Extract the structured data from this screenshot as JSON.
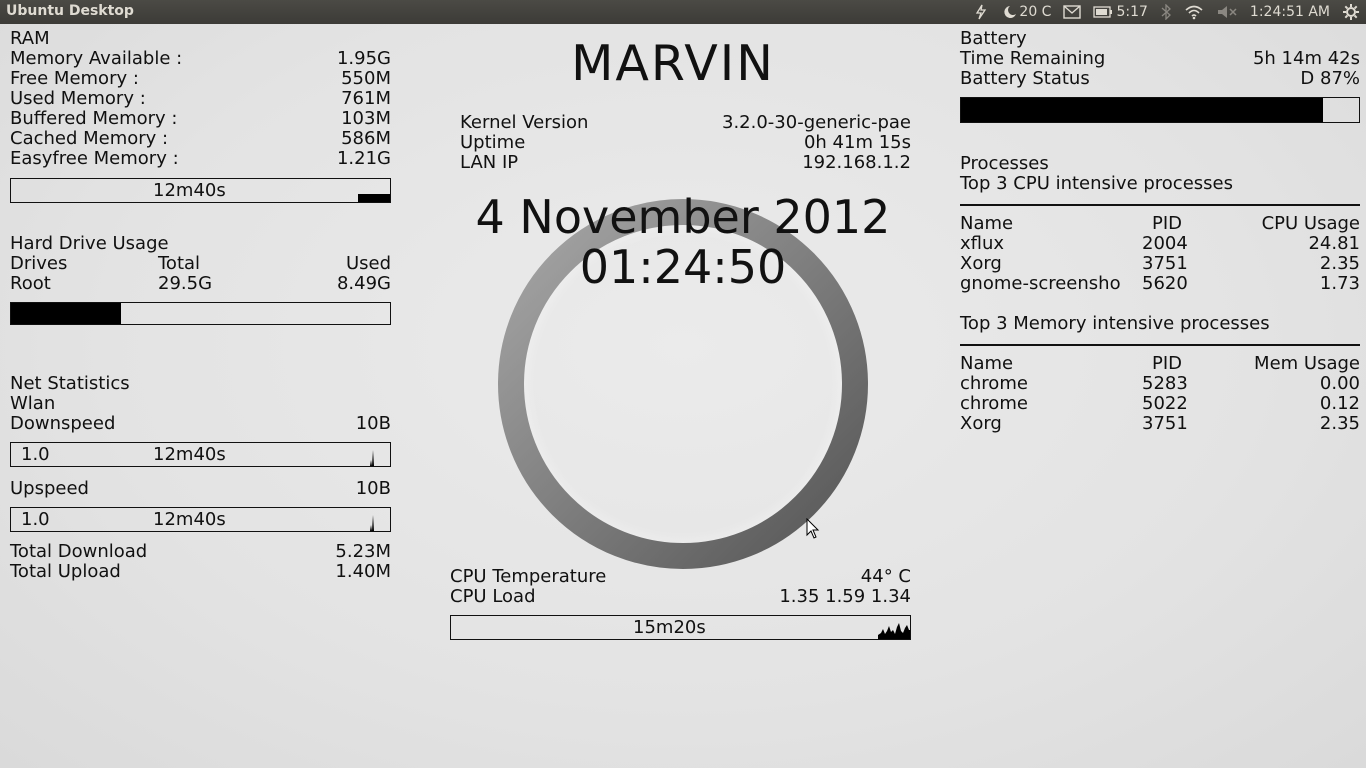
{
  "panel": {
    "title": "Ubuntu Desktop",
    "weather": "20 C",
    "battery_time": "5:17",
    "clock": "1:24:51 AM"
  },
  "ram": {
    "heading": "RAM",
    "rows": [
      {
        "label": "Memory Available :",
        "value": "1.95G"
      },
      {
        "label": "Free Memory :",
        "value": "550M"
      },
      {
        "label": "Used Memory :",
        "value": "761M"
      },
      {
        "label": "Buffered Memory :",
        "value": "103M"
      },
      {
        "label": "Cached Memory :",
        "value": "586M"
      },
      {
        "label": "Easyfree Memory :",
        "value": "1.21G"
      }
    ],
    "graph_label": "12m40s"
  },
  "disk": {
    "heading": "Hard Drive Usage",
    "col_drives": "Drives",
    "col_total": "Total",
    "col_used": "Used",
    "drive": "Root",
    "total": "29.5G",
    "used": "8.49G",
    "used_fraction": 0.29
  },
  "net": {
    "heading": "Net Statistics",
    "iface": "Wlan",
    "down_label": "Downspeed",
    "down_value": "10B",
    "down_scale": "1.0",
    "down_graph_label": "12m40s",
    "up_label": "Upspeed",
    "up_value": "10B",
    "up_scale": "1.0",
    "up_graph_label": "12m40s",
    "total_down_label": "Total Download",
    "total_down_value": "5.23M",
    "total_up_label": "Total Upload",
    "total_up_value": "1.40M"
  },
  "center": {
    "hostname": "MARVIN",
    "kernel_label": "Kernel Version",
    "kernel_value": "3.2.0-30-generic-pae",
    "uptime_label": "Uptime",
    "uptime_value": "0h 41m 15s",
    "lan_label": "LAN IP",
    "lan_value": "192.168.1.2",
    "date": "4 November 2012",
    "time": "01:24:50",
    "cpu_temp_label": "CPU Temperature",
    "cpu_temp_value": "44° C",
    "cpu_load_label": "CPU Load",
    "cpu_load_value": "1.35 1.59 1.34",
    "cpu_graph_label": "15m20s"
  },
  "battery": {
    "heading": "Battery",
    "time_label": "Time Remaining",
    "time_value": "5h 14m 42s",
    "status_label": "Battery Status",
    "status_value": "D 87%",
    "level_fraction": 0.91
  },
  "processes": {
    "heading": "Processes",
    "cpu_heading": "Top 3 CPU intensive processes",
    "cpu_cols": {
      "name": "Name",
      "pid": "PID",
      "usage": "CPU Usage"
    },
    "cpu_rows": [
      {
        "name": "xflux",
        "pid": "2004",
        "usage": "24.81"
      },
      {
        "name": "Xorg",
        "pid": "3751",
        "usage": "2.35"
      },
      {
        "name": "gnome-screensho",
        "pid": "5620",
        "usage": "1.73"
      }
    ],
    "mem_heading": "Top 3 Memory intensive processes",
    "mem_cols": {
      "name": "Name",
      "pid": "PID",
      "usage": "Mem Usage"
    },
    "mem_rows": [
      {
        "name": "chrome",
        "pid": "5283",
        "usage": "0.00"
      },
      {
        "name": "chrome",
        "pid": "5022",
        "usage": "0.12"
      },
      {
        "name": "Xorg",
        "pid": "3751",
        "usage": "2.35"
      }
    ]
  }
}
